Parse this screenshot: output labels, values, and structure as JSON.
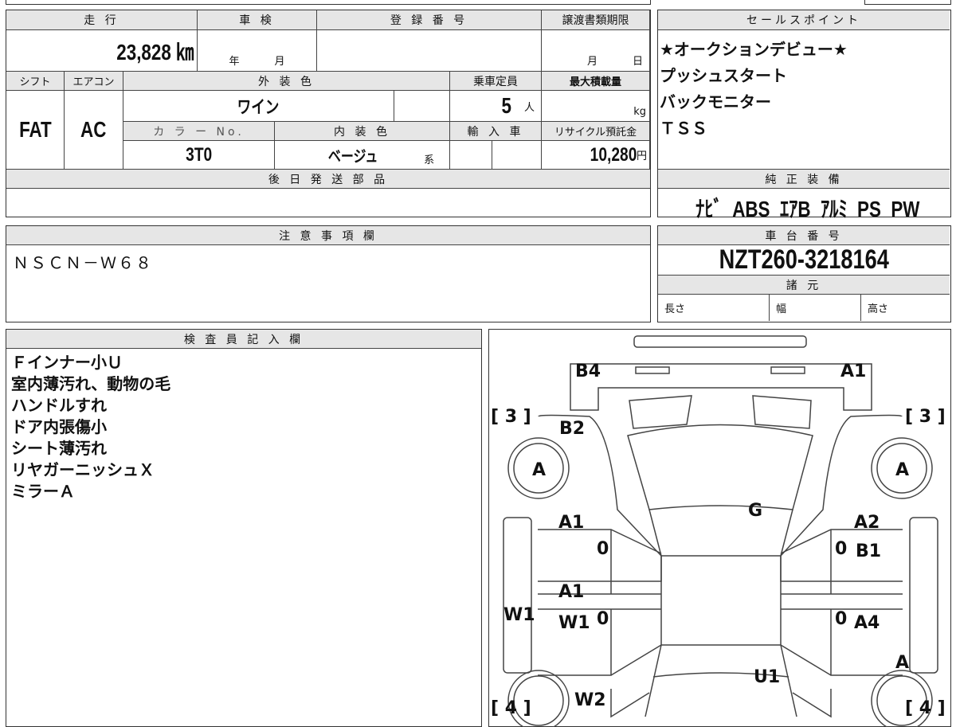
{
  "basic": {
    "mileage_label": "走 行",
    "mileage": "23,828 ㎞",
    "inspection_label": "車 検",
    "inspection_year": "年",
    "inspection_month": "月",
    "registration_label": "登 録 番 号",
    "transfer_deadline_label": "譲渡書類期限",
    "transfer_month": "月",
    "transfer_day": "日",
    "shift_label": "シフト",
    "shift": "FAT",
    "ac_label": "エアコン",
    "ac": "AC",
    "exterior_color_label": "外 装 色",
    "exterior_color": "ワイン",
    "capacity_label": "乗車定員",
    "capacity": "5",
    "capacity_unit": "人",
    "max_load_label": "最大積載量",
    "max_load_unit": "kg",
    "color_no_label": "カ ラ ー No.",
    "color_no": "3T0",
    "interior_color_label": "内 装 色",
    "interior_color": "ベージュ",
    "interior_suffix": "系",
    "import_label": "輸 入 車",
    "recycle_label": "リサイクル預託金",
    "recycle_fee": "10,280",
    "recycle_unit": "円",
    "later_parts_label": "後 日 発 送 部 品"
  },
  "sales_points": {
    "label": "セールスポイント",
    "lines": [
      "★オークションデビュー★",
      "プッシュスタート",
      "バックモニター",
      "ＴＳＳ"
    ]
  },
  "equipment": {
    "label": "純 正 装 備",
    "items": "ﾅﾋﾞ  ABS  ｴｱB  ｱﾙﾐ  PS  PW"
  },
  "notes": {
    "label": "注 意 事 項 欄",
    "text": "ＮＳＣＮ－Ｗ６８"
  },
  "chassis": {
    "label": "車 台 番 号",
    "number": "NZT260-3218164",
    "specs_label": "諸 元",
    "length_label": "長さ",
    "width_label": "幅",
    "height_label": "高さ"
  },
  "inspector": {
    "label": "検 査 員 記 入 欄",
    "lines": [
      "Ｆインナー小Ｕ",
      "室内薄汚れ、動物の毛",
      "ハンドルすれ",
      "ドア内張傷小",
      "シート薄汚れ",
      "リヤガーニッシュＸ",
      "ミラーＡ"
    ]
  },
  "diagram": {
    "marks": [
      "B4",
      "A1",
      "B2",
      "A",
      "A",
      "G",
      "A1",
      "A2",
      "0",
      "0",
      "B1",
      "W1",
      "A1",
      "W1",
      "0",
      "0",
      "A4",
      "A",
      "U1",
      "W2"
    ],
    "bracket_3": "[ 3 ]",
    "bracket_4": "[ 4 ]"
  }
}
